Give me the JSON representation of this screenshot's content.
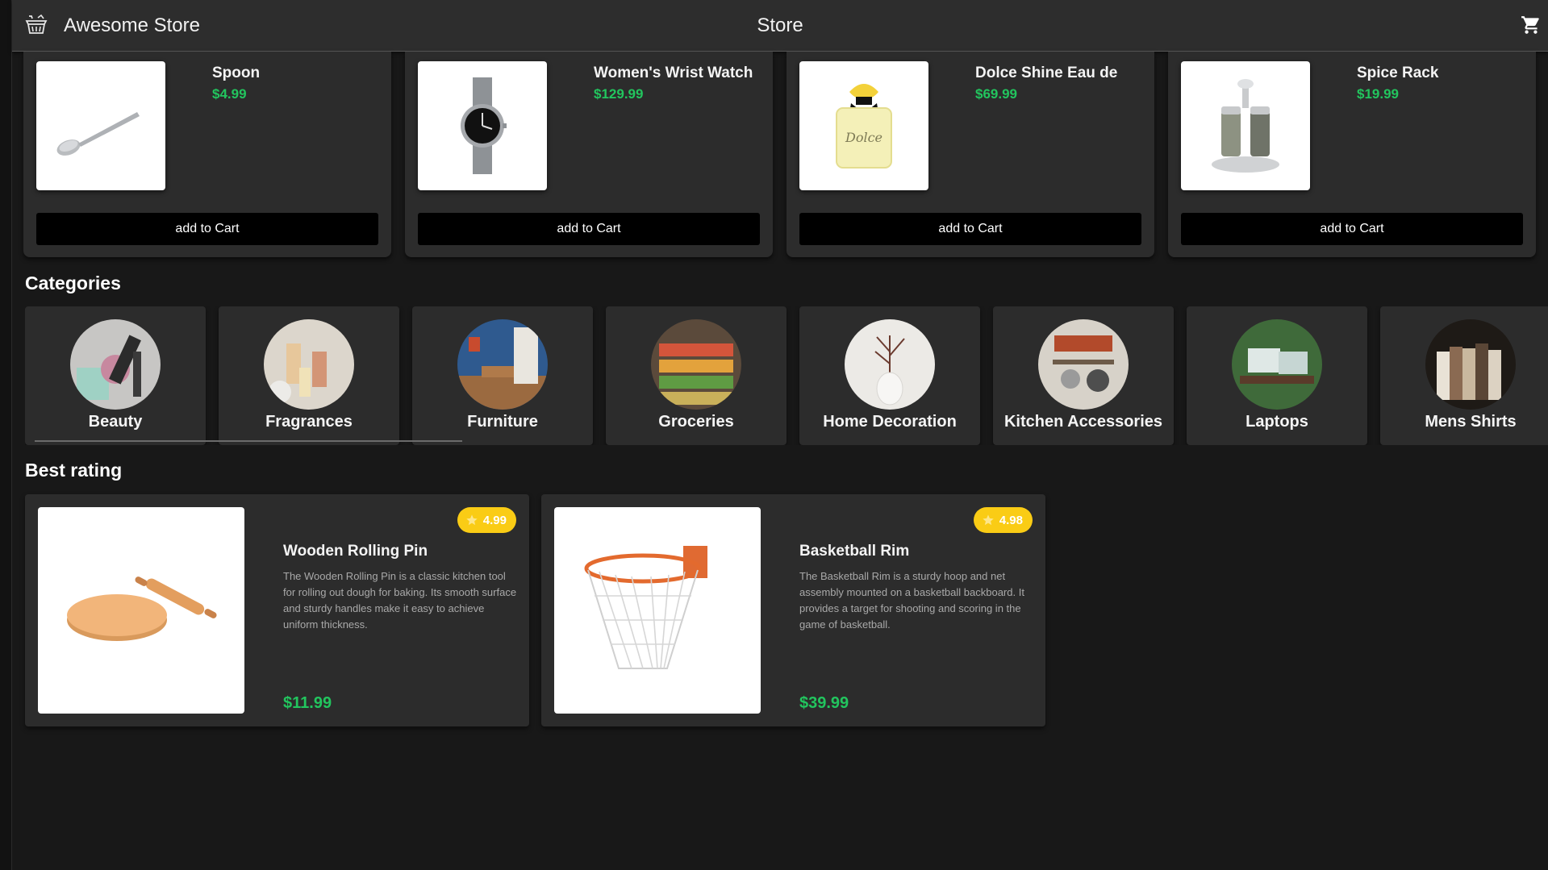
{
  "header": {
    "app_title": "Awesome Store",
    "page_title": "Store",
    "logo_icon": "shopping-basket-icon",
    "cart_icon": "cart-icon"
  },
  "products": [
    {
      "name": "Spoon",
      "price": "$4.99",
      "button": "add to Cart",
      "image": "spoon"
    },
    {
      "name": "Women's Wrist Watch",
      "price": "$129.99",
      "button": "add to Cart",
      "image": "watch"
    },
    {
      "name": "Dolce Shine Eau de",
      "price": "$69.99",
      "button": "add to Cart",
      "image": "perfume"
    },
    {
      "name": "Spice Rack",
      "price": "$19.99",
      "button": "add to Cart",
      "image": "spice-rack"
    }
  ],
  "categories_title": "Categories",
  "categories": [
    {
      "label": "Beauty"
    },
    {
      "label": "Fragrances"
    },
    {
      "label": "Furniture"
    },
    {
      "label": "Groceries"
    },
    {
      "label": "Home Decoration"
    },
    {
      "label": "Kitchen Accessories"
    },
    {
      "label": "Laptops"
    },
    {
      "label": "Mens Shirts"
    }
  ],
  "best_title": "Best rating",
  "best": [
    {
      "name": "Wooden Rolling Pin",
      "rating": "4.99",
      "description": "The Wooden Rolling Pin is a classic kitchen tool for rolling out dough for baking. Its smooth surface and sturdy handles make it easy to achieve uniform thickness.",
      "price": "$11.99"
    },
    {
      "name": "Basketball Rim",
      "rating": "4.98",
      "description": "The Basketball Rim is a sturdy hoop and net assembly mounted on a basketball backboard. It provides a target for shooting and scoring in the game of basketball.",
      "price": "$39.99"
    }
  ],
  "colors": {
    "accent_price": "#22c55e",
    "rating_badge": "#facc15",
    "header_bg": "#2d2d2d",
    "card_bg": "#2c2c2c"
  }
}
